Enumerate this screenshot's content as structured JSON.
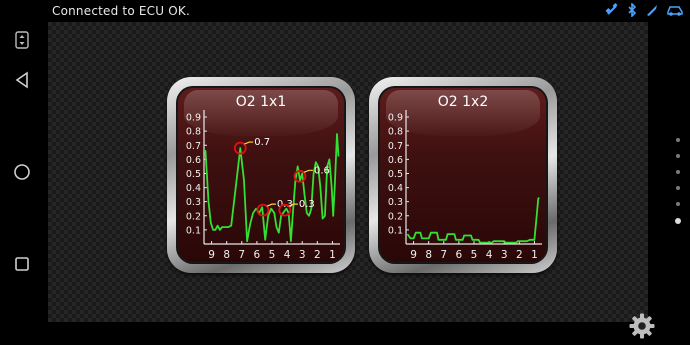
{
  "status_bar": {
    "text": "Connected to ECU OK.",
    "icons": [
      "satellite-icon",
      "bluetooth-icon",
      "engine-icon",
      "car-icon"
    ]
  },
  "nav": {
    "buttons": [
      "menu-icon",
      "back-icon",
      "home-icon",
      "recents-icon"
    ]
  },
  "colors": {
    "trace": "#33e033",
    "marker": "#e01010",
    "label_line": "#ffd23a",
    "face": "#3e1010"
  },
  "gauges": [
    {
      "title": "O2 1x1",
      "chart_data": {
        "type": "line",
        "y_ticks": [
          "0.9",
          "0.8",
          "0.7",
          "0.6",
          "0.5",
          "0.4",
          "0.3",
          "0.2",
          "0.1"
        ],
        "x_ticks": [
          "9",
          "8",
          "7",
          "6",
          "5",
          "4",
          "3",
          "2",
          "1"
        ],
        "ylim": [
          0,
          0.95
        ],
        "xlim": [
          9.5,
          0.5
        ],
        "series": [
          {
            "points": [
              [
                9.5,
                0.66
              ],
              [
                9.4,
                0.66
              ],
              [
                9.2,
                0.3
              ],
              [
                9.05,
                0.15
              ],
              [
                8.9,
                0.1
              ],
              [
                8.75,
                0.1
              ],
              [
                8.6,
                0.13
              ],
              [
                8.45,
                0.1
              ],
              [
                8.3,
                0.12
              ],
              [
                8.1,
                0.12
              ],
              [
                7.9,
                0.12
              ],
              [
                7.7,
                0.13
              ],
              [
                7.4,
                0.4
              ],
              [
                7.1,
                0.68
              ],
              [
                6.85,
                0.45
              ],
              [
                6.65,
                0.02
              ],
              [
                6.45,
                0.14
              ],
              [
                6.25,
                0.22
              ],
              [
                6.05,
                0.25
              ],
              [
                5.85,
                0.22
              ],
              [
                5.65,
                0.26
              ],
              [
                5.45,
                0.03
              ],
              [
                5.25,
                0.2
              ],
              [
                5.05,
                0.25
              ],
              [
                4.85,
                0.22
              ],
              [
                4.7,
                0.12
              ],
              [
                4.55,
                0.08
              ],
              [
                4.4,
                0.2
              ],
              [
                4.2,
                0.23
              ],
              [
                4.05,
                0.25
              ],
              [
                3.9,
                0.22
              ],
              [
                3.75,
                0.02
              ],
              [
                3.6,
                0.25
              ],
              [
                3.45,
                0.45
              ],
              [
                3.3,
                0.55
              ],
              [
                3.15,
                0.45
              ],
              [
                3.0,
                0.5
              ],
              [
                2.85,
                0.35
              ],
              [
                2.7,
                0.22
              ],
              [
                2.55,
                0.2
              ],
              [
                2.4,
                0.25
              ],
              [
                2.25,
                0.5
              ],
              [
                2.1,
                0.58
              ],
              [
                1.95,
                0.55
              ],
              [
                1.8,
                0.4
              ],
              [
                1.65,
                0.18
              ],
              [
                1.5,
                0.2
              ],
              [
                1.35,
                0.55
              ],
              [
                1.2,
                0.6
              ],
              [
                1.05,
                0.4
              ],
              [
                0.95,
                0.2
              ],
              [
                0.85,
                0.4
              ],
              [
                0.7,
                0.78
              ],
              [
                0.6,
                0.62
              ]
            ]
          }
        ],
        "annotations": [
          {
            "label": "0.7",
            "x": 7.1,
            "y": 0.68
          },
          {
            "label": "0.3",
            "x": 5.6,
            "y": 0.24
          },
          {
            "label": "0.3",
            "x": 4.15,
            "y": 0.24
          },
          {
            "label": "0.6",
            "x": 3.15,
            "y": 0.48
          }
        ]
      }
    },
    {
      "title": "O2 1x2",
      "chart_data": {
        "type": "line",
        "y_ticks": [
          "0.9",
          "0.8",
          "0.7",
          "0.6",
          "0.5",
          "0.4",
          "0.3",
          "0.2",
          "0.1"
        ],
        "x_ticks": [
          "9",
          "8",
          "7",
          "6",
          "5",
          "4",
          "3",
          "2",
          "1"
        ],
        "ylim": [
          0,
          0.95
        ],
        "xlim": [
          9.5,
          0.5
        ],
        "series": [
          {
            "points": [
              [
                9.4,
                0.07
              ],
              [
                9.2,
                0.04
              ],
              [
                9.0,
                0.04
              ],
              [
                8.85,
                0.08
              ],
              [
                8.55,
                0.08
              ],
              [
                8.45,
                0.04
              ],
              [
                8.0,
                0.04
              ],
              [
                7.85,
                0.08
              ],
              [
                7.45,
                0.08
              ],
              [
                7.35,
                0.03
              ],
              [
                6.85,
                0.03
              ],
              [
                6.75,
                0.07
              ],
              [
                6.3,
                0.07
              ],
              [
                6.2,
                0.03
              ],
              [
                5.75,
                0.03
              ],
              [
                5.65,
                0.06
              ],
              [
                5.2,
                0.06
              ],
              [
                5.1,
                0.03
              ],
              [
                4.7,
                0.03
              ],
              [
                4.6,
                0.01
              ],
              [
                3.8,
                0.01
              ],
              [
                3.7,
                0.02
              ],
              [
                3.0,
                0.02
              ],
              [
                2.9,
                0.01
              ],
              [
                2.2,
                0.01
              ],
              [
                2.1,
                0.02
              ],
              [
                1.5,
                0.02
              ],
              [
                1.3,
                0.03
              ],
              [
                1.0,
                0.03
              ],
              [
                0.85,
                0.2
              ],
              [
                0.75,
                0.32
              ],
              [
                0.7,
                0.33
              ]
            ]
          }
        ],
        "annotations": []
      }
    }
  ]
}
